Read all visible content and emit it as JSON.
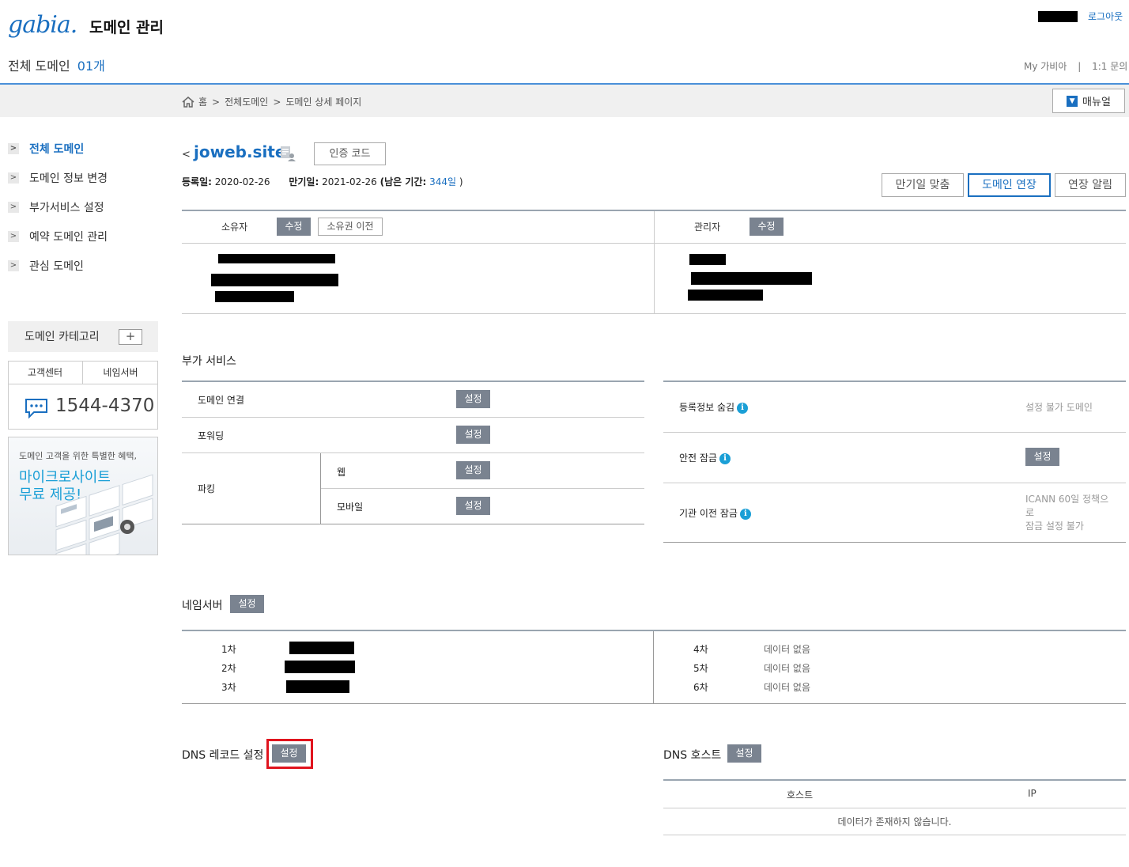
{
  "header": {
    "logo": "gabia.",
    "title": "도메인 관리",
    "logout": "로그아웃",
    "summary_label": "전체 도메인",
    "summary_count": "01개",
    "my_gabia": "My 가비아",
    "separator": "|",
    "inquiry": "1:1 문의"
  },
  "breadcrumb": {
    "home": "홈",
    "sep1": ">",
    "all_domains": "전체도메인",
    "sep2": ">",
    "detail": "도메인 상세 페이지",
    "manual_button": "매뉴얼"
  },
  "sidebar": {
    "items": [
      {
        "label": "전체 도메인",
        "active": true
      },
      {
        "label": "도메인 정보 변경"
      },
      {
        "label": "부가서비스 설정"
      },
      {
        "label": "예약 도메인 관리"
      },
      {
        "label": "관심 도메인"
      }
    ],
    "category_label": "도메인 카테고리",
    "category_add": "+",
    "support_tab": "고객센터",
    "nameserver_tab": "네임서버",
    "phone": "1544-4370",
    "banner_small": "도메인 고객을 위한 특별한 혜택,",
    "banner_line1": "마이크로사이트",
    "banner_line2": "무료 제공!"
  },
  "domain": {
    "back": "<",
    "name": "joweb.site",
    "auth_code_button": "인증 코드",
    "reg_label": "등록일:",
    "reg_date": "2020-02-26",
    "exp_label": "만기일:",
    "exp_date": "2021-02-26",
    "remain_label": "(남은 기간:",
    "remain_days": "344일",
    "remain_close": ")",
    "btn_match_expiry": "만기일 맞춤",
    "btn_extend": "도메인 연장",
    "btn_alert": "연장 알림"
  },
  "contacts": {
    "owner_label": "소유자",
    "owner_edit": "수정",
    "owner_transfer": "소유권 이전",
    "admin_label": "관리자",
    "admin_edit": "수정"
  },
  "addons": {
    "title": "부가 서비스",
    "connect": "도메인 연결",
    "forwarding": "포워딩",
    "parking": "파킹",
    "web": "웹",
    "mobile": "모바일",
    "set": "설정",
    "privacy": "등록정보 숨김",
    "privacy_status": "설정 불가 도메인",
    "safe_lock": "안전 잠금",
    "transfer_lock": "기관 이전 잠금",
    "transfer_status_1": "ICANN 60일 정책으",
    "transfer_status_2": "로",
    "transfer_status_3": "잠금 설정 불가",
    "info": "i"
  },
  "nameserver": {
    "title": "네임서버",
    "set": "설정",
    "rows_left": [
      "1차",
      "2차",
      "3차"
    ],
    "rows_right": [
      "4차",
      "5차",
      "6차"
    ],
    "no_data": "데이터 없음"
  },
  "dns": {
    "record_title": "DNS 레코드 설정",
    "record_set": "설정",
    "host_title": "DNS 호스트",
    "host_set": "설정",
    "col_host": "호스트",
    "col_ip": "IP",
    "empty": "데이터가 존재하지 않습니다."
  },
  "colors": {
    "accent": "#1a6fc0",
    "gray_button": "#7a8390",
    "highlight": "#e0141e"
  }
}
